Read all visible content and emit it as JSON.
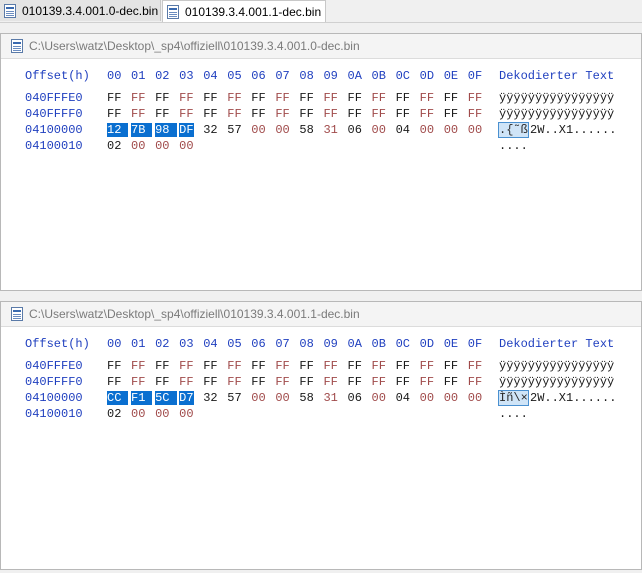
{
  "tabs": [
    {
      "label": "010139.3.4.001.0-dec.bin",
      "active": false
    },
    {
      "label": "010139.3.4.001.1-dec.bin",
      "active": true
    }
  ],
  "header": {
    "offset": "Offset(h)",
    "columns": [
      "00",
      "01",
      "02",
      "03",
      "04",
      "05",
      "06",
      "07",
      "08",
      "09",
      "0A",
      "0B",
      "0C",
      "0D",
      "0E",
      "0F"
    ],
    "text": "Dekodierter Text"
  },
  "panes": [
    {
      "title": "C:\\Users\\watz\\Desktop\\_sp4\\offiziell\\010139.3.4.001.0-dec.bin",
      "rows": [
        {
          "offset": "040FFFE0",
          "bytes": [
            "FF",
            "FF",
            "FF",
            "FF",
            "FF",
            "FF",
            "FF",
            "FF",
            "FF",
            "FF",
            "FF",
            "FF",
            "FF",
            "FF",
            "FF",
            "FF"
          ],
          "decoded_sel": "",
          "decoded": "ÿÿÿÿÿÿÿÿÿÿÿÿÿÿÿÿ"
        },
        {
          "offset": "040FFFF0",
          "bytes": [
            "FF",
            "FF",
            "FF",
            "FF",
            "FF",
            "FF",
            "FF",
            "FF",
            "FF",
            "FF",
            "FF",
            "FF",
            "FF",
            "FF",
            "FF",
            "FF"
          ],
          "decoded_sel": "",
          "decoded": "ÿÿÿÿÿÿÿÿÿÿÿÿÿÿÿÿ"
        },
        {
          "offset": "04100000",
          "bytes": [
            "12",
            "7B",
            "98",
            "DF",
            "32",
            "57",
            "00",
            "00",
            "58",
            "31",
            "06",
            "00",
            "04",
            "00",
            "00",
            "00"
          ],
          "selected": [
            0,
            1,
            2,
            3
          ],
          "decoded_sel": ".{˜ß",
          "decoded": "2W..X1......"
        },
        {
          "offset": "04100010",
          "bytes": [
            "02",
            "00",
            "00",
            "00"
          ],
          "decoded_sel": "",
          "decoded": "...."
        }
      ]
    },
    {
      "title": "C:\\Users\\watz\\Desktop\\_sp4\\offiziell\\010139.3.4.001.1-dec.bin",
      "rows": [
        {
          "offset": "040FFFE0",
          "bytes": [
            "FF",
            "FF",
            "FF",
            "FF",
            "FF",
            "FF",
            "FF",
            "FF",
            "FF",
            "FF",
            "FF",
            "FF",
            "FF",
            "FF",
            "FF",
            "FF"
          ],
          "decoded_sel": "",
          "decoded": "ÿÿÿÿÿÿÿÿÿÿÿÿÿÿÿÿ"
        },
        {
          "offset": "040FFFF0",
          "bytes": [
            "FF",
            "FF",
            "FF",
            "FF",
            "FF",
            "FF",
            "FF",
            "FF",
            "FF",
            "FF",
            "FF",
            "FF",
            "FF",
            "FF",
            "FF",
            "FF"
          ],
          "decoded_sel": "",
          "decoded": "ÿÿÿÿÿÿÿÿÿÿÿÿÿÿÿÿ"
        },
        {
          "offset": "04100000",
          "bytes": [
            "CC",
            "F1",
            "5C",
            "D7",
            "32",
            "57",
            "00",
            "00",
            "58",
            "31",
            "06",
            "00",
            "04",
            "00",
            "00",
            "00"
          ],
          "selected": [
            0,
            1,
            2,
            3
          ],
          "decoded_sel": "Ìñ\\×",
          "decoded": "2W..X1......"
        },
        {
          "offset": "04100010",
          "bytes": [
            "02",
            "00",
            "00",
            "00"
          ],
          "decoded_sel": "",
          "decoded": "...."
        }
      ]
    }
  ],
  "colors": {
    "blue_text": "#1f3fbf",
    "selection": "#0a6fd0",
    "faint_byte": "#a04a4a"
  }
}
